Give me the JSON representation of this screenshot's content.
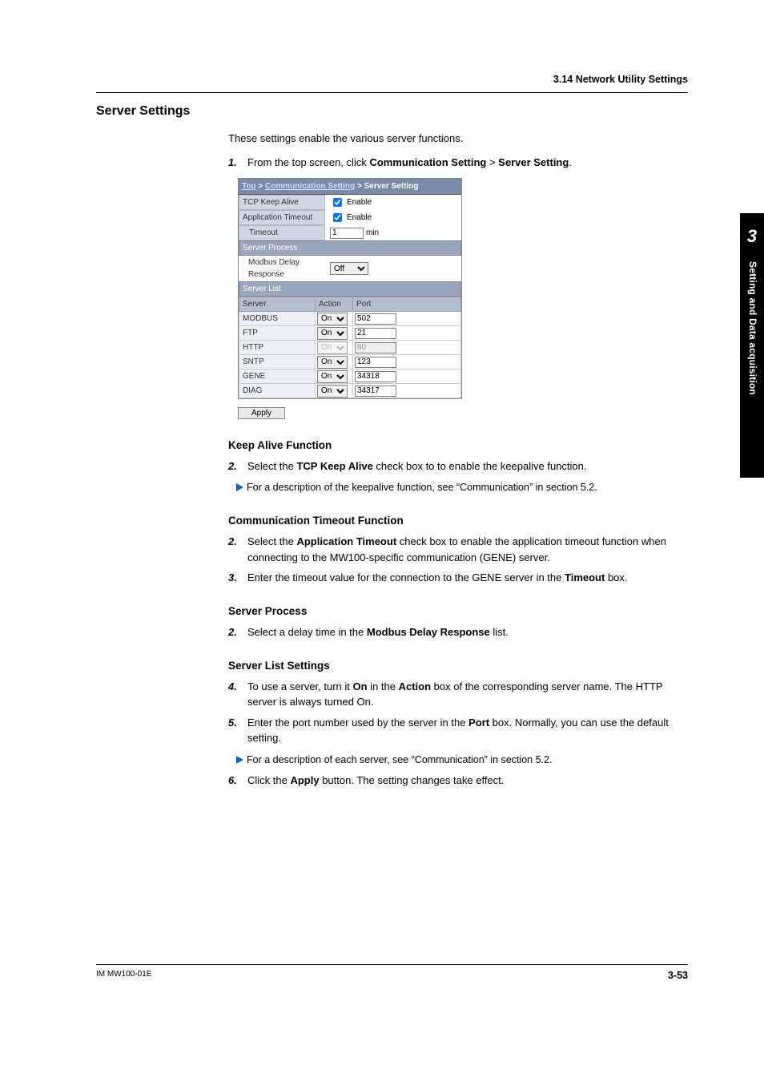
{
  "header": {
    "section": "3.14  Network Utility Settings"
  },
  "title": "Server Settings",
  "intro": "These settings enable the various server functions.",
  "step1": {
    "num": "1.",
    "pre": "From the top screen, click ",
    "b1": "Communication Setting",
    "sep": " > ",
    "b2": "Server Setting",
    "post": "."
  },
  "screenshot": {
    "crumb_top": "Top",
    "crumb_mid": "Communication Setting",
    "crumb_last": "Server Setting",
    "tcp_label": "TCP Keep Alive",
    "tcp_enable": "Enable",
    "app_label": "Application Timeout",
    "app_enable": "Enable",
    "timeout_label": "Timeout",
    "timeout_value": "1",
    "timeout_unit": "min",
    "server_process_bar": "Server Process",
    "modbus_delay_label": "Modbus Delay Response",
    "modbus_delay_value": "Off",
    "server_list_bar": "Server List",
    "col_server": "Server",
    "col_action": "Action",
    "col_port": "Port",
    "rows": [
      {
        "name": "MODBUS",
        "action": "On",
        "port": "502",
        "enabled": true
      },
      {
        "name": "FTP",
        "action": "On",
        "port": "21",
        "enabled": true
      },
      {
        "name": "HTTP",
        "action": "On",
        "port": "80",
        "enabled": false
      },
      {
        "name": "SNTP",
        "action": "On",
        "port": "123",
        "enabled": true
      },
      {
        "name": "GENE",
        "action": "On",
        "port": "34318",
        "enabled": true
      },
      {
        "name": "DIAG",
        "action": "On",
        "port": "34317",
        "enabled": true
      }
    ],
    "apply": "Apply"
  },
  "keepalive": {
    "heading": "Keep Alive Function",
    "step2_num": "2.",
    "step2_pre": "Select the ",
    "step2_b": "TCP Keep Alive",
    "step2_post": " check box to to enable the keepalive function.",
    "note": "For a description of the keepalive function, see “Communication” in section 5.2."
  },
  "commto": {
    "heading": "Communication Timeout Function",
    "s2_num": "2.",
    "s2_pre": "Select the ",
    "s2_b": "Application Timeout",
    "s2_post": " check box to enable the application timeout function when connecting to the MW100-specific communication (GENE) server.",
    "s3_num": "3.",
    "s3_pre": "Enter the timeout value for the connection to the GENE server in the ",
    "s3_b": "Timeout",
    "s3_post": " box."
  },
  "proc": {
    "heading": "Server Process",
    "s2_num": "2.",
    "s2_pre": "Select a delay time in the ",
    "s2_b": "Modbus Delay Response",
    "s2_post": " list."
  },
  "list": {
    "heading": "Server List Settings",
    "s4_num": "4.",
    "s4_pre": "To use a server, turn it ",
    "s4_b1": "On",
    "s4_mid": " in the ",
    "s4_b2": "Action",
    "s4_post": " box of the corresponding server name. The HTTP server is always turned On.",
    "s5_num": "5.",
    "s5_pre": "Enter the port number used by the server in the ",
    "s5_b": "Port",
    "s5_post": " box. Normally, you can use the default setting.",
    "note": "For a description of each server, see “Communication” in section 5.2.",
    "s6_num": "6.",
    "s6_pre": "Click the ",
    "s6_b": "Apply",
    "s6_post": " button. The setting changes take effect."
  },
  "sidetab": {
    "num": "3",
    "label": "Setting and Data acquisition"
  },
  "footer": {
    "doc": "IM MW100-01E",
    "page": "3-53"
  }
}
